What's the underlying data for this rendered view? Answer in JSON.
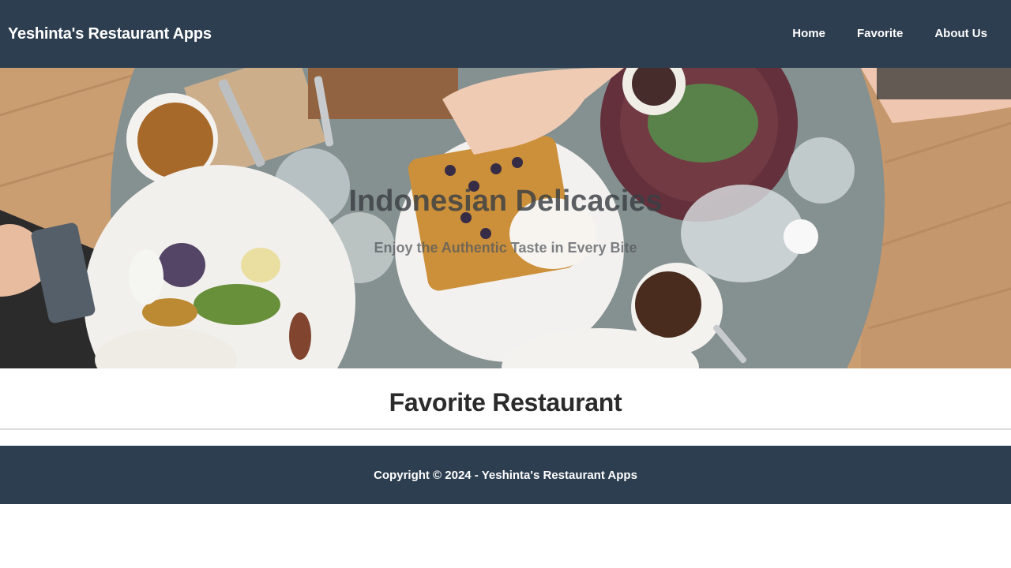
{
  "app_bar": {
    "brand": "Yeshinta's Restaurant Apps",
    "nav": [
      {
        "label": "Home"
      },
      {
        "label": "Favorite"
      },
      {
        "label": "About Us"
      }
    ]
  },
  "hero": {
    "title": "Indonesian Delicacies",
    "subtitle": "Enjoy the Authentic Taste in Every Bite",
    "image": "restaurant-table-food-photo"
  },
  "main": {
    "title": "Favorite Restaurant"
  },
  "footer": {
    "copyright": "Copyright © 2024 - Yeshinta's Restaurant Apps"
  },
  "colors": {
    "header_bg": "#2d3e50",
    "footer_bg": "#2d3e50",
    "text_on_dark": "#ffffff"
  }
}
